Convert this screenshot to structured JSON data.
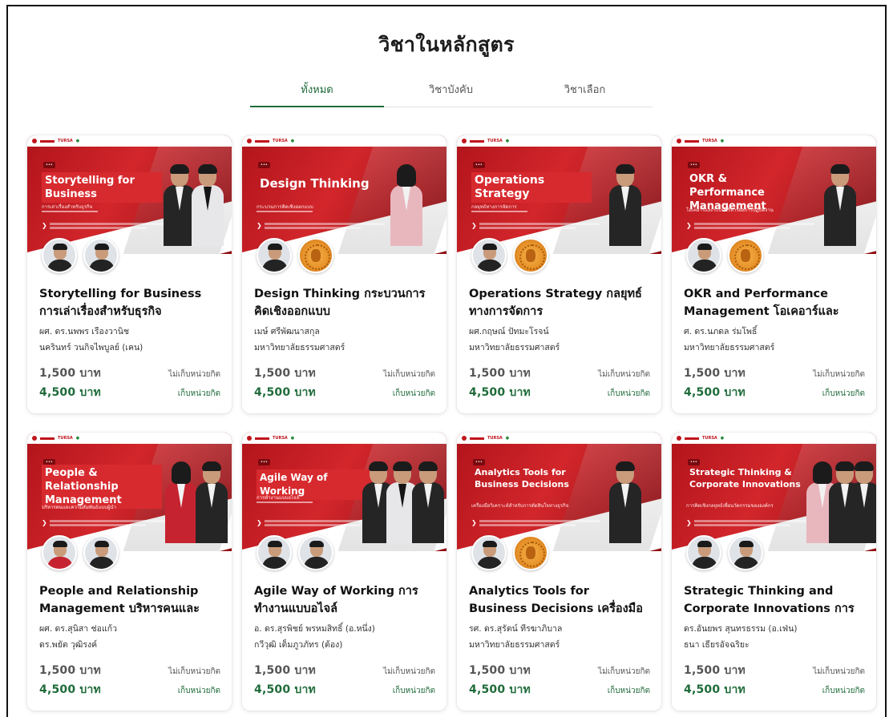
{
  "page": {
    "title": "วิชาในหลักสูตร"
  },
  "tabs": [
    {
      "label": "ทั้งหมด",
      "active": true
    },
    {
      "label": "วิชาบังคับ",
      "active": false
    },
    {
      "label": "วิชาเลือก",
      "active": false
    }
  ],
  "colors": {
    "accent_green": "#1f6b3a",
    "banner_red": "#c8202a"
  },
  "courses": [
    {
      "banner_title": "Storytelling for Business",
      "banner_subtitle": "การเล่าเรื่องสำหรับธุรกิจ",
      "title": "Storytelling for Business การเล่าเรื่องสำหรับธุรกิจ",
      "instructor_1": "ผศ. ดร.นพพร เรืองวานิช",
      "instructor_2": "นครินทร์ วนกิจไพบูลย์ (เคน)",
      "price_non_credit": "1,500 บาท",
      "label_non_credit": "ไม่เก็บหน่วยกิต",
      "price_credit": "4,500 บาท",
      "label_credit": "เก็บหน่วยกิต"
    },
    {
      "banner_title": "Design Thinking",
      "banner_subtitle": "กระบวนการคิดเชิงออกแบบ",
      "title": "Design Thinking กระบวนการคิดเชิงออกแบบ",
      "instructor_1": "เมษ์ ศรีพัฒนาสกุล",
      "instructor_2": "มหาวิทยาลัยธรรมศาสตร์",
      "price_non_credit": "1,500 บาท",
      "label_non_credit": "ไม่เก็บหน่วยกิต",
      "price_credit": "4,500 บาท",
      "label_credit": "เก็บหน่วยกิต"
    },
    {
      "banner_title": "Operations Strategy",
      "banner_subtitle": "กลยุทธ์ทางการจัดการ",
      "title": "Operations Strategy กลยุทธ์ทางการจัดการ",
      "instructor_1": "ผศ.กฤษณ์ ปัทมะโรจน์",
      "instructor_2": "มหาวิทยาลัยธรรมศาสตร์",
      "price_non_credit": "1,500 บาท",
      "label_non_credit": "ไม่เก็บหน่วยกิต",
      "price_credit": "4,500 บาท",
      "label_credit": "เก็บหน่วยกิต"
    },
    {
      "banner_title": "OKR & Performance Management",
      "banner_subtitle": "โอเคอาร์และระบบบริหารผลการปฏิบัติงาน",
      "title": "OKR and Performance Management โอเคอาร์และระบ...",
      "instructor_1": "ศ. ดร.นภดล ร่มโพธิ์",
      "instructor_2": "มหาวิทยาลัยธรรมศาสตร์",
      "price_non_credit": "1,500 บาท",
      "label_non_credit": "ไม่เก็บหน่วยกิต",
      "price_credit": "4,500 บาท",
      "label_credit": "เก็บหน่วยกิต"
    },
    {
      "banner_title": "People & Relationship Management",
      "banner_subtitle": "บริหารคนและความสัมพันธ์แบบผู้นำ",
      "title": "People and Relationship Management บริหารคนและคว...",
      "instructor_1": "ผศ. ดร.สุนิสา ช่อแก้ว",
      "instructor_2": "ดร.พยัต วุฒิรงค์",
      "price_non_credit": "1,500 บาท",
      "label_non_credit": "ไม่เก็บหน่วยกิต",
      "price_credit": "4,500 บาท",
      "label_credit": "เก็บหน่วยกิต"
    },
    {
      "banner_title": "Agile Way of Working",
      "banner_subtitle": "การทำงานแบบอไจล์",
      "title": "Agile Way of Working การทำงานแบบอไจล์",
      "instructor_1": "อ. ดร.สุรพิชย์ พรหมสิทธิ์ (อ.หนึ่ง)",
      "instructor_2": "กวีวุฒิ เต็มภูวภัทร (ต้อง)",
      "price_non_credit": "1,500 บาท",
      "label_non_credit": "ไม่เก็บหน่วยกิต",
      "price_credit": "4,500 บาท",
      "label_credit": "เก็บหน่วยกิต"
    },
    {
      "banner_title": "Analytics Tools for Business Decisions",
      "banner_subtitle": "เครื่องมือวิเคราะห์สำหรับการตัดสินใจทางธุรกิจ",
      "title": "Analytics Tools for Business Decisions เครื่องมือวิเคราะห์...",
      "instructor_1": "รศ. ดร.สุรัตน์ ทีรฆาภิบาล",
      "instructor_2": "มหาวิทยาลัยธรรมศาสตร์",
      "price_non_credit": "1,500 บาท",
      "label_non_credit": "ไม่เก็บหน่วยกิต",
      "price_credit": "4,500 บาท",
      "label_credit": "เก็บหน่วยกิต"
    },
    {
      "banner_title": "Strategic Thinking & Corporate Innovations",
      "banner_subtitle": "การคิดเชิงกลยุทธ์เพื่อนวัตกรรมขององค์กร",
      "title": "Strategic Thinking and Corporate Innovations การคิ...",
      "instructor_1": "ดร.อันยพร สุนทรธรรม (อ.เฟ่น)",
      "instructor_2": "ธนา เธียรอัจฉริยะ",
      "price_non_credit": "1,500 บาท",
      "label_non_credit": "ไม่เก็บหน่วยกิต",
      "price_credit": "4,500 บาท",
      "label_credit": "เก็บหน่วยกิต"
    }
  ]
}
